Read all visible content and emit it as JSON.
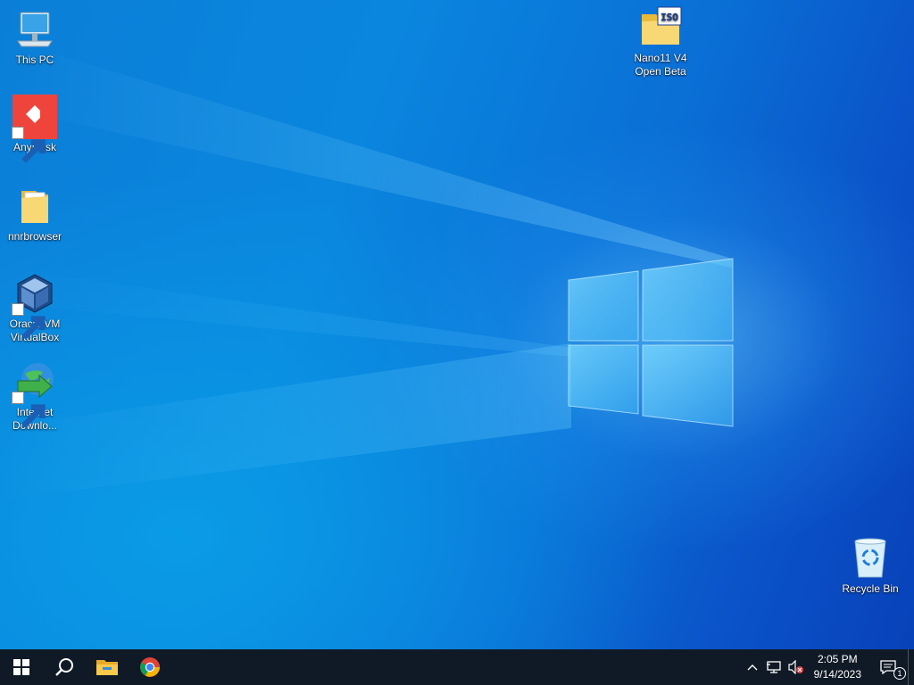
{
  "desktop": {
    "icons": [
      {
        "label": "This PC",
        "icon": "computer-icon"
      },
      {
        "label": "AnyDesk",
        "icon": "anydesk-icon"
      },
      {
        "label": "nnrbrowser",
        "icon": "folder-icon"
      },
      {
        "label": "Oracle VM\nVirtualBox",
        "icon": "virtualbox-icon"
      },
      {
        "label": "Internet\nDownlo...",
        "icon": "internet-download-manager-icon"
      },
      {
        "label": "Nano11 V4\nOpen Beta",
        "icon": "iso-folder-icon"
      },
      {
        "label": "Recycle Bin",
        "icon": "recycle-bin-icon"
      }
    ]
  },
  "taskbar": {
    "buttons": [
      {
        "name": "start",
        "icon": "windows-start-icon"
      },
      {
        "name": "search",
        "icon": "search-icon"
      },
      {
        "name": "file-explorer",
        "icon": "file-explorer-icon"
      },
      {
        "name": "chrome",
        "icon": "chrome-icon"
      }
    ],
    "tray": {
      "chevron_icon": "chevron-up-icon",
      "network_icon": "network-icon",
      "volume_icon": "volume-muted-icon",
      "time": "2:05 PM",
      "date": "9/14/2023",
      "notification_count": "1"
    }
  },
  "colors": {
    "taskbar_bg": "#101a26",
    "anydesk_red": "#ef443b",
    "desktop_blue": "#0a86de"
  }
}
